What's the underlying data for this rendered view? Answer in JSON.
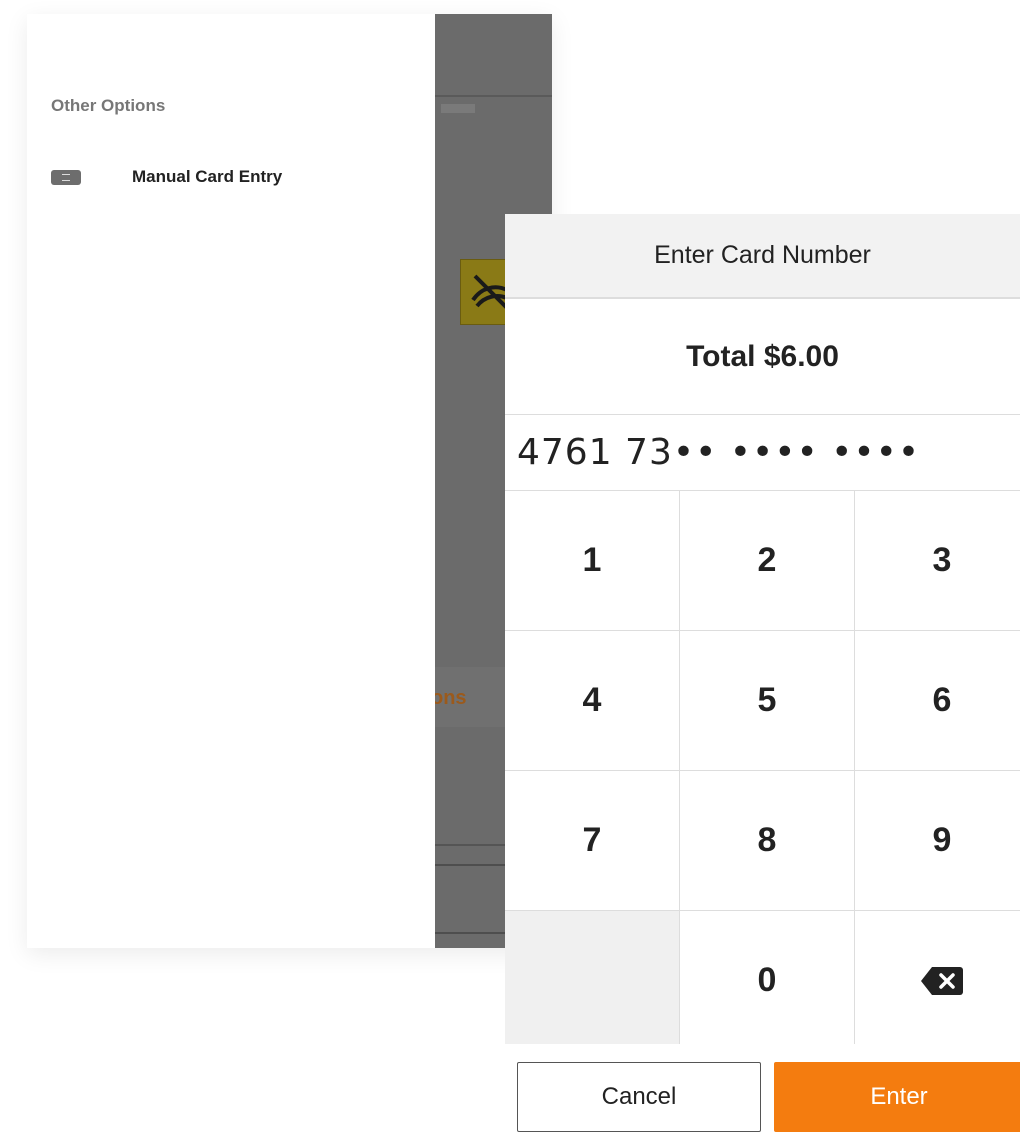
{
  "drawer": {
    "heading": "Other Options",
    "items": [
      {
        "label": "Manual Card Entry",
        "icon": "card-icon"
      }
    ]
  },
  "background": {
    "partial_text": "ons",
    "accent_color": "#9b5a1c"
  },
  "dialog": {
    "title": "Enter Card Number",
    "total": "Total $6.00",
    "card_number": "4761 73•• •••• ••••",
    "keypad": {
      "k1": "1",
      "k2": "2",
      "k3": "3",
      "k4": "4",
      "k5": "5",
      "k6": "6",
      "k7": "7",
      "k8": "8",
      "k9": "9",
      "k0": "0",
      "backspace_icon": "backspace-icon"
    },
    "cancel_label": "Cancel",
    "enter_label": "Enter",
    "enter_color": "#f47c0f"
  }
}
